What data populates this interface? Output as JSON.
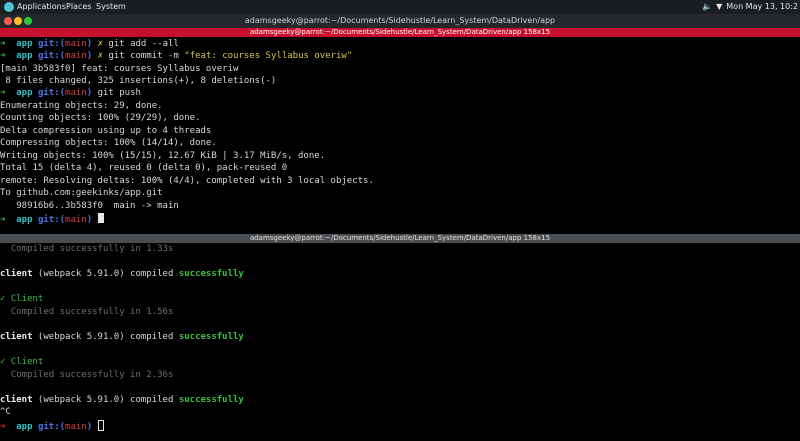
{
  "sysbar": {
    "menus": [
      "Applications",
      "Places",
      "System"
    ],
    "datetime": "Mon May 13, 10:2"
  },
  "titlebar": {
    "title": "adamsgeeky@parrot:~/Documents/Sidehustle/Learn_System/DataDriven/app"
  },
  "top_pane": {
    "header": "adamsgeeky@parrot:~/Documents/Sidehustle/Learn_System/DataDriven/app 158x15",
    "prompt_dir": "app",
    "git_label": "git:(",
    "branch": "main",
    "git_close": ")",
    "x": "✗",
    "cmd1": "git add --all",
    "cmd2_pre": "git commit -m ",
    "cmd2_msg": "\"feat: courses Syllabus overiw\"",
    "out1": "[main 3b583f0] feat: courses Syllabus overiw",
    "out2": " 8 files changed, 325 insertions(+), 8 deletions(-)",
    "cmd3": "git push",
    "push_lines": [
      "Enumerating objects: 29, done.",
      "Counting objects: 100% (29/29), done.",
      "Delta compression using up to 4 threads",
      "Compressing objects: 100% (14/14), done.",
      "Writing objects: 100% (15/15), 12.67 KiB | 3.17 MiB/s, done.",
      "Total 15 (delta 4), reused 0 (delta 0), pack-reused 0",
      "remote: Resolving deltas: 100% (4/4), completed with 3 local objects.",
      "To github.com:geekinks/app.git",
      "   98916b6..3b583f0  main -> main"
    ]
  },
  "bottom_pane": {
    "header": "adamsgeeky@parrot:~/Documents/Sidehustle/Learn_System/DataDriven/app 158x15",
    "compiled_1": "  Compiled successfully in 1.33s",
    "client_word": "client",
    "webpack": " (webpack 5.91.0) compiled ",
    "successfully": "successfully",
    "check_client": "✓ Client",
    "compiled_2": "  Compiled successfully in 1.56s",
    "compiled_3": "  Compiled successfully in 2.36s",
    "ctrl_c": "^C",
    "prompt_dir": "app",
    "git_label": "git:(",
    "branch": "main",
    "git_close": ")"
  }
}
